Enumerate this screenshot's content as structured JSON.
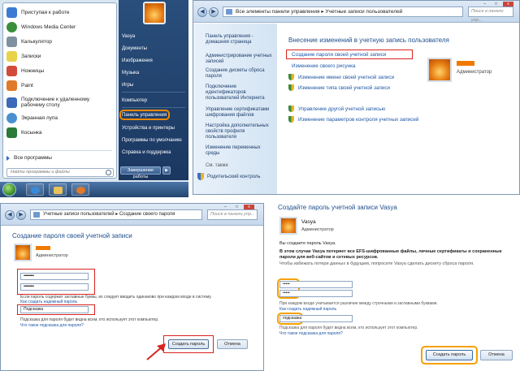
{
  "start_menu": {
    "programs": [
      {
        "label": "Приступая к работе",
        "color": "#3b7bd4"
      },
      {
        "label": "Windows Media Center",
        "color": "#3a8f3a"
      },
      {
        "label": "Калькулятор",
        "color": "#8090a0"
      },
      {
        "label": "Записки",
        "color": "#e8d24a"
      },
      {
        "label": "Ножницы",
        "color": "#d24a3a"
      },
      {
        "label": "Paint",
        "color": "#e07a2a"
      },
      {
        "label": "Подключение к удаленному рабочему столу",
        "color": "#3a6ab8"
      },
      {
        "label": "Экранная лупа",
        "color": "#4a90d0"
      },
      {
        "label": "Косынка",
        "color": "#2a7a3a"
      }
    ],
    "all_programs": "Все программы",
    "search_placeholder": "Найти программы и файлы",
    "right_items": [
      "Vasya",
      "Документы",
      "Изображения",
      "Музыка",
      "Игры",
      "Компьютер",
      "Панель управления",
      "Устройства и принтеры",
      "Программы по умолчанию",
      "Справка и поддержка"
    ],
    "shutdown": "Завершение работы"
  },
  "control_panel": {
    "breadcrumb": [
      "Все элементы панели управления",
      "Учетные записи пользователей"
    ],
    "search_placeholder": "Поиск в панели упр...",
    "sidebar_links": [
      "Панель управления - домашняя страница",
      "Администрирование учетных записей",
      "Создание дискеты сброса пароля",
      "Подключение идентификаторов пользователей Интернета",
      "Управление сертификатами шифрования файлов",
      "Настройка дополнительных свойств профиля пользователя",
      "Изменение переменных среды"
    ],
    "see_also": "См. также",
    "parental": "Родительский контроль",
    "title": "Внесение изменений в учетную запись пользователя",
    "tasks": [
      "Создание пароля своей учетной записи",
      "Изменение своего рисунка",
      "Изменение имени своей учетной записи",
      "Изменение типа своей учетной записи"
    ],
    "tasks_other": [
      "Управление другой учетной записью",
      "Изменение параметров контроля учетных записей"
    ],
    "account_role": "Администратор"
  },
  "create_password": {
    "breadcrumb": [
      "Учетные записи пользователей",
      "Создание своего пароля"
    ],
    "search_placeholder": "Поиск в панели упр...",
    "title": "Создание пароля своей учетной записи",
    "role": "Администратор",
    "password": "••••••••••",
    "confirm": "••••••••••",
    "case_note": "Если пароль содержит заглавные буквы, их следует вводить одинаково при каждом входе в систему.",
    "strong_link": "Как создать надежный пароль",
    "hint_value": "Подсказка",
    "hint_note": "Подсказка для пароля будет видна всем, кто использует этот компьютер.",
    "hint_link": "Что такое подсказка для пароля?",
    "create_button": "Создать пароль",
    "cancel_button": "Отмена"
  },
  "vasya_dialog": {
    "title": "Создайте пароль учетной записи Vasya",
    "name": "Vasya",
    "role": "Администратор",
    "line1": "Вы создаете пароль Vasya.",
    "warning": "В этом случае Vasya потеряет все EFS-шифрованные файлы, личные сертификаты и сохраненные пароли для веб-сайтов и сетевых ресурсов.",
    "reset_note": "Чтобы избежать потери данных в будущем, попросите Vasya сделать дискету сброса пароля.",
    "password": "•••••",
    "confirm": "•••••",
    "case_note": "При каждом входе учитывается различие между строчными и заглавными буквами.",
    "strong_link": "Как создать надежный пароль",
    "hint_value": "подсказка",
    "hint_note": "Подсказка для пароля будет видна всем, кто использует этот компьютер.",
    "hint_link": "Что такое подсказка для пароля?",
    "create_button": "Создать пароль",
    "cancel_button": "Отмена"
  },
  "colors": {
    "highlight_red": "#d9231d",
    "highlight_orange": "#f5a000",
    "link_blue": "#1d56a8"
  }
}
